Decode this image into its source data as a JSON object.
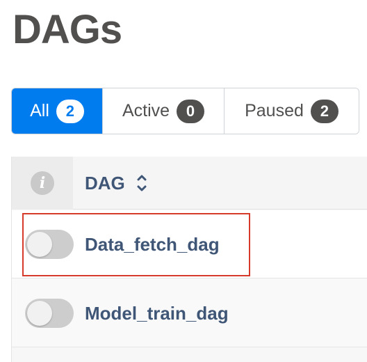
{
  "page": {
    "title": "DAGs"
  },
  "filters": [
    {
      "label": "All",
      "count": "2",
      "active": true
    },
    {
      "label": "Active",
      "count": "0",
      "active": false
    },
    {
      "label": "Paused",
      "count": "2",
      "active": false
    }
  ],
  "table": {
    "info_icon": "info-icon",
    "column_header": "DAG",
    "sort_icon": "sort-icon",
    "rows": [
      {
        "dag_id": "Data_fetch_dag",
        "toggle": "off"
      },
      {
        "dag_id": "Model_train_dag",
        "toggle": "off"
      }
    ]
  },
  "colors": {
    "accent": "#017cee",
    "link": "#3f5677",
    "highlight": "#d63a2b"
  }
}
